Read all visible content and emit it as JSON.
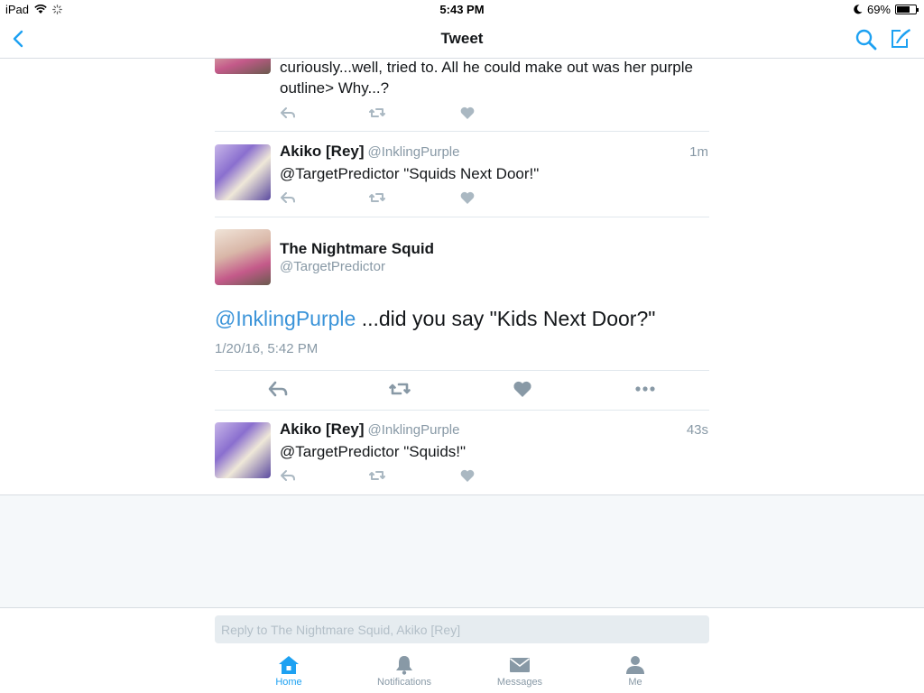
{
  "status_bar": {
    "device": "iPad",
    "time": "5:43 PM",
    "battery": "69%",
    "battery_level": 0.69
  },
  "nav": {
    "title": "Tweet"
  },
  "tweets": [
    {
      "text_partial": "curiously...well, tried to. All he could make out was her purple outline> Why...?"
    },
    {
      "name": "Akiko [Rey]",
      "handle": "@InklingPurple",
      "time": "1m",
      "text": "@TargetPredictor \"Squids Next Door!\""
    },
    {
      "name": "Akiko [Rey]",
      "handle": "@InklingPurple",
      "time": "43s",
      "text": "@TargetPredictor \"Squids!\""
    }
  ],
  "focus_tweet": {
    "name": "The Nightmare Squid",
    "handle": "@TargetPredictor",
    "mention": "@InklingPurple",
    "text": " ...did you say \"Kids Next Door?\"",
    "date": "1/20/16, 5:42 PM"
  },
  "reply": {
    "placeholder": "Reply to The Nightmare Squid, Akiko [Rey]"
  },
  "tabs": [
    {
      "label": "Home",
      "active": true
    },
    {
      "label": "Notifications"
    },
    {
      "label": "Messages"
    },
    {
      "label": "Me"
    }
  ],
  "colors": {
    "accent": "#1da1f2",
    "link": "#3b94d9",
    "icon_gray": "#aab8c2",
    "text": "#14171a",
    "secondary": "#8899a6"
  }
}
